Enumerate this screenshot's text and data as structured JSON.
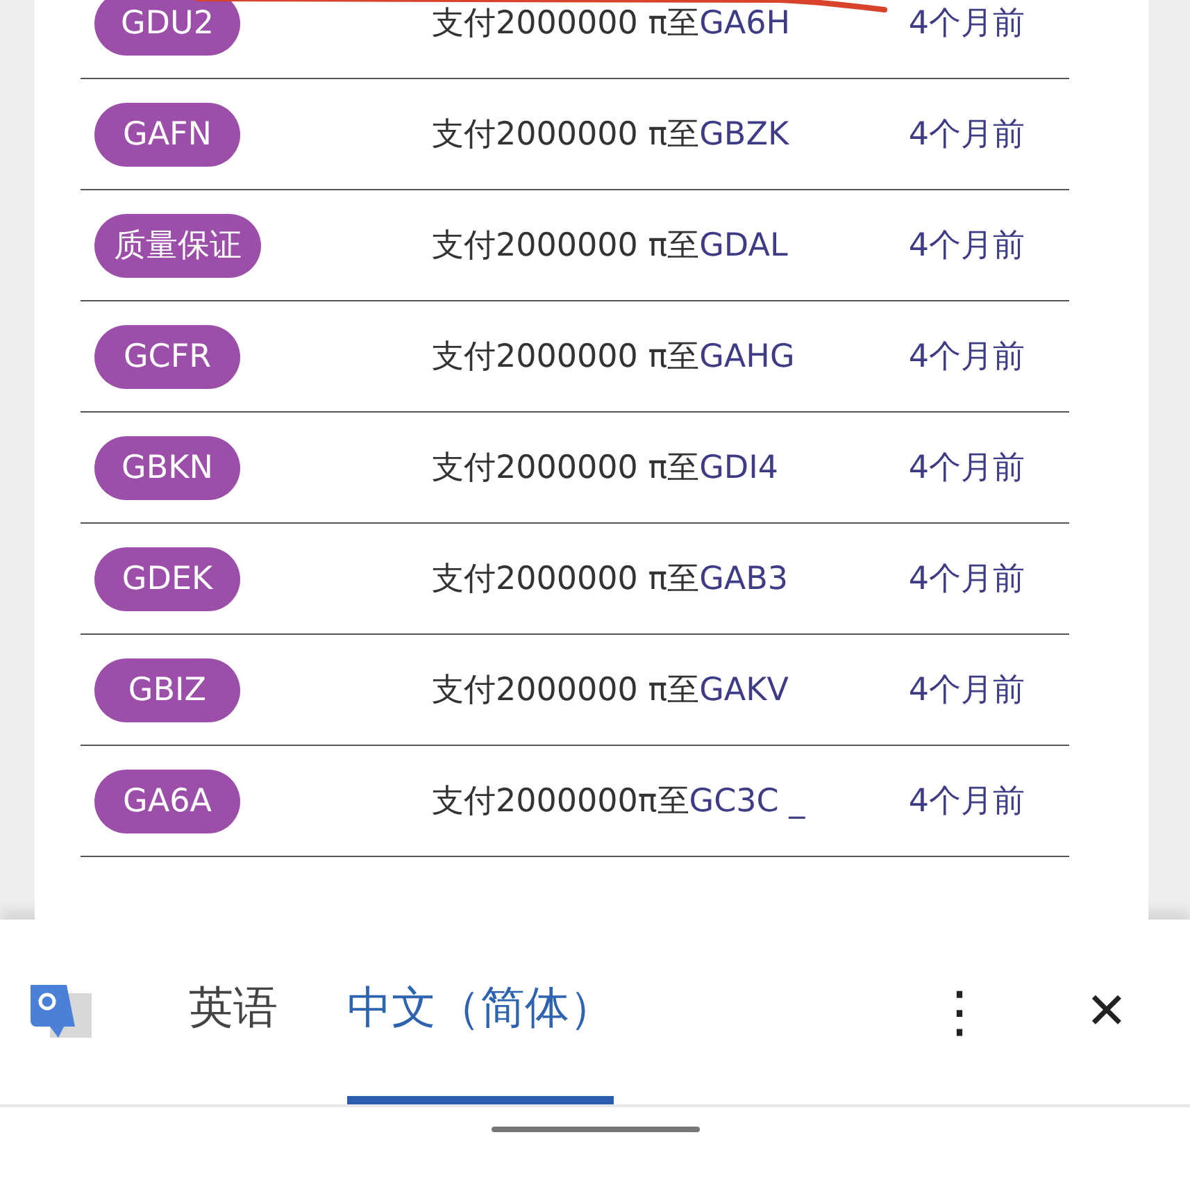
{
  "transactions": [
    {
      "badge": "GDU2",
      "payment": "支付2000000 π至",
      "recipient": "GA6H",
      "time": "4个月前"
    },
    {
      "badge": "GAFN",
      "payment": "支付2000000 π至",
      "recipient": "GBZK",
      "time": "4个月前"
    },
    {
      "badge": "质量保证",
      "payment": "支付2000000 π至",
      "recipient": "GDAL",
      "time": "4个月前"
    },
    {
      "badge": "GCFR",
      "payment": "支付2000000 π至",
      "recipient": "GAHG",
      "time": "4个月前"
    },
    {
      "badge": "GBKN",
      "payment": "支付2000000 π至",
      "recipient": "GDI4",
      "time": "4个月前"
    },
    {
      "badge": "GDEK",
      "payment": "支付2000000 π至",
      "recipient": "GAB3",
      "time": "4个月前"
    },
    {
      "badge": "GBIZ",
      "payment": "支付2000000 π至",
      "recipient": "GAKV",
      "time": "4个月前"
    },
    {
      "badge": "GA6A",
      "payment": "支付2000000π至",
      "recipient": "GC3C _",
      "time": "4个月前"
    }
  ],
  "translate_bar": {
    "tabs": [
      {
        "label": "英语",
        "selected": false
      },
      {
        "label": "中文（简体）",
        "selected": true
      }
    ],
    "menu": "⋮",
    "close": "✕"
  }
}
